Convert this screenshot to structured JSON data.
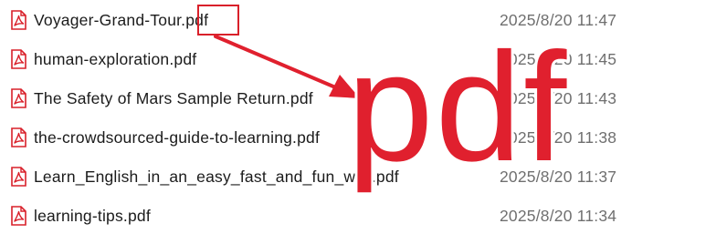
{
  "files": [
    {
      "name": "Voyager-Grand-Tour.pdf",
      "modified": "2025/8/20 11:47",
      "icon": "pdf-file-icon"
    },
    {
      "name": "human-exploration.pdf",
      "modified": "2025/8/20 11:45",
      "icon": "pdf-file-icon"
    },
    {
      "name": "The Safety of Mars Sample Return.pdf",
      "modified": "2025/8/20 11:43",
      "icon": "pdf-file-icon"
    },
    {
      "name": "the-crowdsourced-guide-to-learning.pdf",
      "modified": "2025/8/20 11:38",
      "icon": "pdf-file-icon"
    },
    {
      "name": "Learn_English_in_an_easy_fast_and_fun_way.pdf",
      "modified": "2025/8/20 11:37",
      "icon": "pdf-file-icon"
    },
    {
      "name": "learning-tips.pdf",
      "modified": "2025/8/20 11:34",
      "icon": "pdf-file-icon"
    }
  ],
  "annotation": {
    "extension_label": "pdf",
    "color": "#e0202e"
  },
  "colors": {
    "filename_text": "#1b1b1b",
    "date_text": "#6f6f6f",
    "icon_red": "#d9202a"
  }
}
